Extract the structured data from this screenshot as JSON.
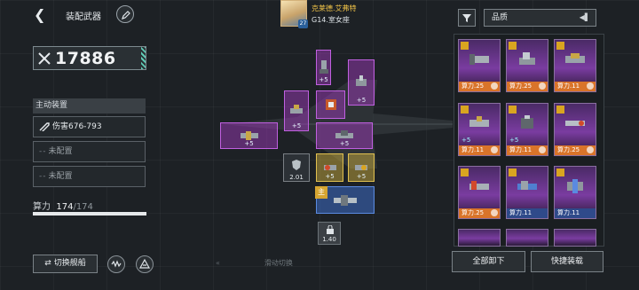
{
  "header": {
    "title": "装配武器",
    "back_icon": "back-arrow-icon",
    "edit_icon": "edit-pen-icon"
  },
  "power": {
    "value": "17886",
    "icon": "crossed-swords-icon"
  },
  "active_equipment": {
    "heading": "主动装置",
    "slots": [
      {
        "label": "伤害676-793",
        "state": "filled",
        "icon": "missile-icon"
      },
      {
        "label": "未配置",
        "state": "empty"
      },
      {
        "label": "未配置",
        "state": "empty"
      }
    ]
  },
  "compute": {
    "label": "算力",
    "current": "174",
    "max": "/174",
    "fill_fraction": 1.0
  },
  "bottom_left": {
    "switch_ship_label": "切换舰船",
    "swap_icon": "swap-arrows-icon",
    "btn2_icon": "wave-icon",
    "btn3_icon": "ship-outline-icon",
    "slide_hint": "滑动切换"
  },
  "commander": {
    "name": "克莱德.艾弗特",
    "rank": "G14.室女座",
    "level_badge": "27"
  },
  "ship_parts": {
    "plus_label": "+5",
    "main_tag": "主",
    "slot_a_weight": "2.01",
    "slot_b_weight": "1.40"
  },
  "inventory": {
    "sort_label": "品质",
    "filter_icon": "filter-funnel-icon",
    "cards": [
      {
        "label": "算力.25",
        "plus": "",
        "equipped": true,
        "strip": "orange"
      },
      {
        "label": "算力.25",
        "plus": "",
        "equipped": true,
        "strip": "orange"
      },
      {
        "label": "算力.11",
        "plus": "",
        "equipped": true,
        "strip": "orange"
      },
      {
        "label": "算力.11",
        "plus": "+5",
        "equipped": true,
        "strip": "orange"
      },
      {
        "label": "算力.11",
        "plus": "+5",
        "equipped": true,
        "strip": "orange"
      },
      {
        "label": "算力.25",
        "plus": "",
        "equipped": true,
        "strip": "orange"
      },
      {
        "label": "算力.25",
        "plus": "",
        "equipped": true,
        "strip": "orange"
      },
      {
        "label": "算力.11",
        "plus": "",
        "equipped": false,
        "strip": "blue"
      },
      {
        "label": "算力.11",
        "plus": "",
        "equipped": false,
        "strip": "blue"
      }
    ]
  },
  "actions": {
    "unload_all": "全部卸下",
    "quick_equip": "快捷装载"
  },
  "colors": {
    "accent_teal": "#5fc9b4",
    "purple_slot": "#c060e0",
    "gold_slot": "#e0c050",
    "blue_slot": "#5a8ae0",
    "orange_strip": "#d9742a",
    "name_gold": "#f0c247"
  }
}
